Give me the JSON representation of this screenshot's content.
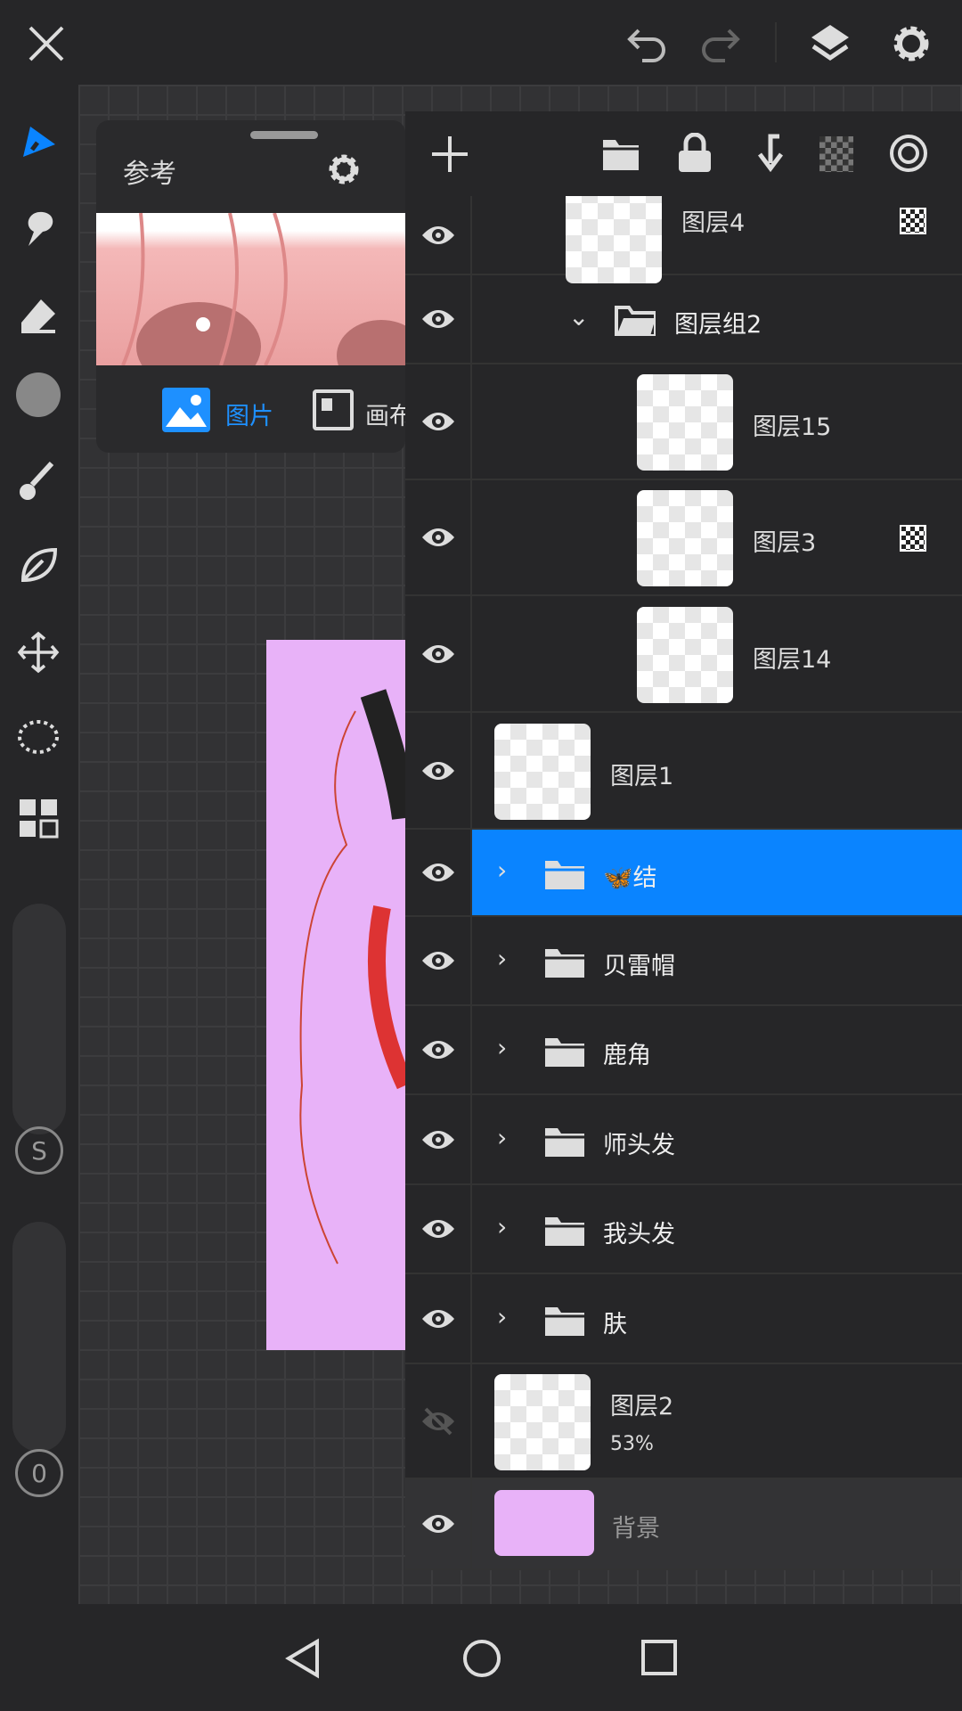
{
  "reference": {
    "title": "参考",
    "tab_image": "图片",
    "tab_canvas": "画布"
  },
  "layers": [
    {
      "name": "图层4",
      "type": "layer",
      "visible": true,
      "alpha_lock": true
    },
    {
      "name": "图层组2",
      "type": "group",
      "expanded": true,
      "visible": true
    },
    {
      "name": "图层15",
      "type": "layer",
      "visible": true
    },
    {
      "name": "图层3",
      "type": "layer",
      "visible": true,
      "alpha_lock": true
    },
    {
      "name": "图层14",
      "type": "layer",
      "visible": true
    },
    {
      "name": "图层1",
      "type": "layer",
      "visible": true
    },
    {
      "name": "🦋结",
      "type": "group",
      "visible": true,
      "selected": true
    },
    {
      "name": "贝雷帽",
      "type": "group",
      "visible": true
    },
    {
      "name": "鹿角",
      "type": "group",
      "visible": true
    },
    {
      "name": "师头发",
      "type": "group",
      "visible": true
    },
    {
      "name": "我头发",
      "type": "group",
      "visible": true
    },
    {
      "name": "肤",
      "type": "group",
      "visible": true
    },
    {
      "name": "图层2",
      "type": "layer",
      "visible": false,
      "opacity": "53%"
    },
    {
      "name": "背景",
      "type": "background",
      "visible": true,
      "color": "#e8b2f8"
    }
  ],
  "toolbar": {
    "size_label": "S",
    "opacity_label": "0"
  },
  "colors": {
    "accent": "#0a84ff",
    "background_layer": "#e8b2f8"
  }
}
